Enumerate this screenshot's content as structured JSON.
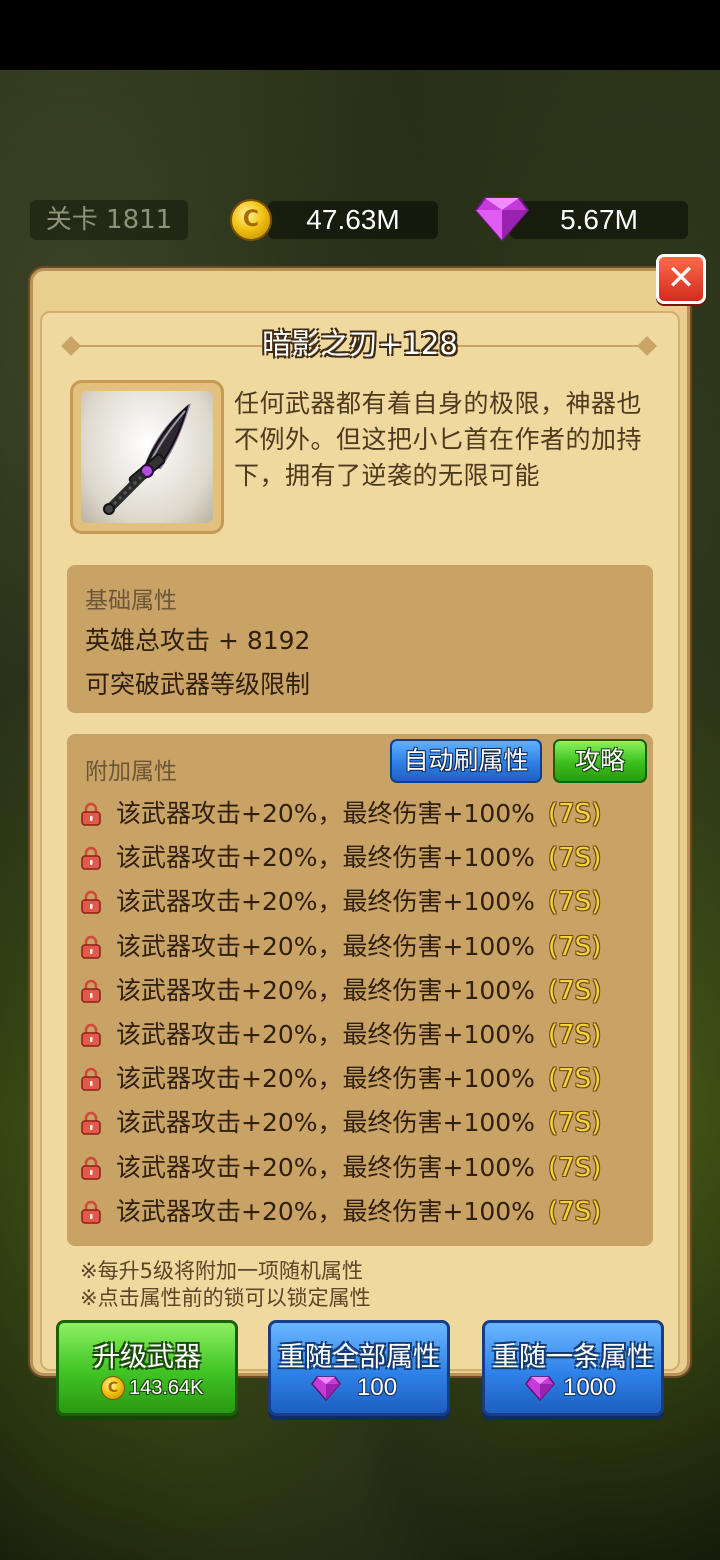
{
  "hud": {
    "stage_label": "关卡 1811",
    "coins": "47.63M",
    "gems": "5.67M",
    "coin_icon_glyph": "C"
  },
  "dialog": {
    "close_glyph": "✕",
    "title": "暗影之刃+128",
    "description": "任何武器都有着自身的极限，神器也不例外。但这把小匕首在作者的加持下，拥有了逆袭的无限可能",
    "weapon_icon": "dagger-icon",
    "base_section": {
      "title": "基础属性",
      "lines": [
        "英雄总攻击 + 8192",
        "可突破武器等级限制"
      ]
    },
    "extra_section": {
      "title": "附加属性",
      "auto_refresh_label": "自动刷属性",
      "guide_label": "攻略",
      "attributes": [
        {
          "text": "该武器攻击+20%，最终伤害+100%",
          "tier": "(7S)"
        },
        {
          "text": "该武器攻击+20%，最终伤害+100%",
          "tier": "(7S)"
        },
        {
          "text": "该武器攻击+20%，最终伤害+100%",
          "tier": "(7S)"
        },
        {
          "text": "该武器攻击+20%，最终伤害+100%",
          "tier": "(7S)"
        },
        {
          "text": "该武器攻击+20%，最终伤害+100%",
          "tier": "(7S)"
        },
        {
          "text": "该武器攻击+20%，最终伤害+100%",
          "tier": "(7S)"
        },
        {
          "text": "该武器攻击+20%，最终伤害+100%",
          "tier": "(7S)"
        },
        {
          "text": "该武器攻击+20%，最终伤害+100%",
          "tier": "(7S)"
        },
        {
          "text": "该武器攻击+20%，最终伤害+100%",
          "tier": "(7S)"
        },
        {
          "text": "该武器攻击+20%，最终伤害+100%",
          "tier": "(7S)"
        }
      ]
    },
    "notes": [
      "※每升5级将附加一项随机属性",
      "※点击属性前的锁可以锁定属性"
    ],
    "buttons": {
      "upgrade": {
        "label": "升级武器",
        "cost": "143.64K",
        "icon": "coin-icon"
      },
      "reroll_all": {
        "label": "重随全部属性",
        "cost": "100",
        "icon": "gem-icon"
      },
      "reroll_one": {
        "label": "重随一条属性",
        "cost": "1000",
        "icon": "gem-icon"
      }
    }
  },
  "colors": {
    "panel_bg": "#f0d99f",
    "section_bg": "#c9a266",
    "tier_yellow": "#f6d23b",
    "btn_green": "#40c324",
    "btn_blue": "#2f82e8",
    "close_red": "#d32b1e"
  }
}
